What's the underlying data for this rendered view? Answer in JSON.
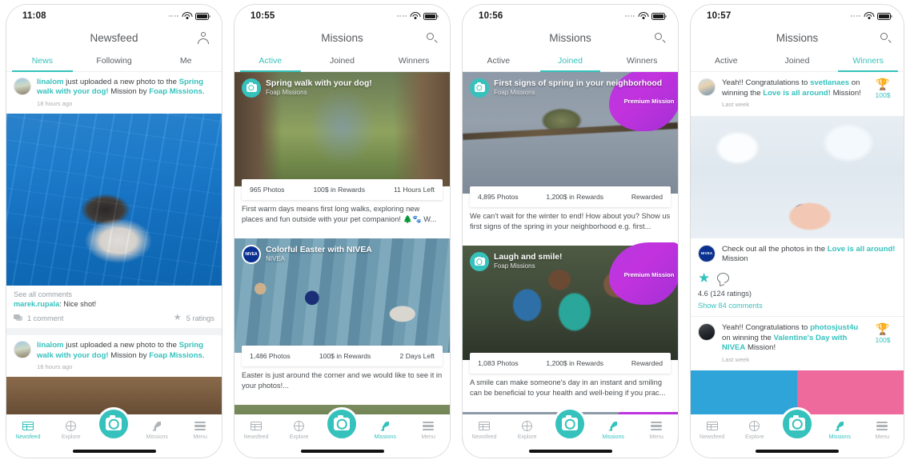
{
  "screens": [
    {
      "status": {
        "time": "11:08"
      },
      "nav": {
        "title": "Newsfeed",
        "action_icon": "person-icon"
      },
      "tabs": [
        {
          "label": "News",
          "active": true
        },
        {
          "label": "Following",
          "active": false
        },
        {
          "label": "Me",
          "active": false
        }
      ],
      "posts": [
        {
          "user": "linalom",
          "text_1": " just uploaded a new photo to the ",
          "mission": "Spring walk with your dog!",
          "text_2": " Mission by ",
          "brand": "Foap Missions",
          "text_3": ".",
          "time": "18 hours ago",
          "see_all": "See all comments",
          "comment_user": "marek.rupala",
          "comment_text": ": Nice shot!",
          "comment_count": "1 comment",
          "ratings": "5 ratings"
        },
        {
          "user": "linalom",
          "text_1": " just uploaded a new photo to the ",
          "mission": "Spring walk with your dog!",
          "text_2": " Mission by ",
          "brand": "Foap Missions",
          "text_3": ".",
          "time": "18 hours ago"
        }
      ],
      "tabbar": [
        {
          "label": "Newsfeed",
          "icon": "feed-icon",
          "active": true
        },
        {
          "label": "Explore",
          "icon": "globe-icon",
          "active": false
        },
        {
          "label": "Missions",
          "icon": "rocket-icon",
          "active": false
        },
        {
          "label": "Menu",
          "icon": "hamburger-icon",
          "active": false
        }
      ]
    },
    {
      "status": {
        "time": "10:55"
      },
      "nav": {
        "title": "Missions",
        "action_icon": "search-icon"
      },
      "tabs": [
        {
          "label": "Active",
          "active": true
        },
        {
          "label": "Joined",
          "active": false
        },
        {
          "label": "Winners",
          "active": false
        }
      ],
      "missions": [
        {
          "title": "Spring walk with your dog!",
          "sponsor": "Foap Missions",
          "logo": "camera-icon",
          "premium": false,
          "photos": "965 Photos",
          "rewards": "100$ in Rewards",
          "status": "11 Hours Left",
          "desc": "First warm days means first long walks, exploring new places and fun outside with your pet companion! 🌲🐾 W..."
        },
        {
          "title": "Colorful Easter with NIVEA",
          "sponsor": "NIVEA",
          "logo": "nivea-logo",
          "premium": false,
          "photos": "1,486 Photos",
          "rewards": "100$ in Rewards",
          "status": "2 Days Left",
          "desc": "Easter is just around the corner and we would like to see it in your photos!..."
        }
      ],
      "tabbar": [
        {
          "label": "Newsfeed",
          "icon": "feed-icon",
          "active": false
        },
        {
          "label": "Explore",
          "icon": "globe-icon",
          "active": false
        },
        {
          "label": "Missions",
          "icon": "rocket-icon",
          "active": true
        },
        {
          "label": "Menu",
          "icon": "hamburger-icon",
          "active": false
        }
      ]
    },
    {
      "status": {
        "time": "10:56"
      },
      "nav": {
        "title": "Missions",
        "action_icon": "search-icon"
      },
      "tabs": [
        {
          "label": "Active",
          "active": false
        },
        {
          "label": "Joined",
          "active": true
        },
        {
          "label": "Winners",
          "active": false
        }
      ],
      "missions": [
        {
          "title": "First signs of spring in your neighborhood",
          "sponsor": "Foap Missions",
          "logo": "camera-icon",
          "premium": true,
          "premium_label": "Premium Mission",
          "photos": "4,895 Photos",
          "rewards": "1,200$ in Rewards",
          "status": "Rewarded",
          "desc": "We can't wait for the winter to end! How about you? Show us first signs of the spring in your neighborhood e.g. first..."
        },
        {
          "title": "Laugh and smile!",
          "sponsor": "Foap Missions",
          "logo": "camera-icon",
          "premium": true,
          "premium_label": "Premium Mission",
          "photos": "1,083 Photos",
          "rewards": "1,200$ in Rewards",
          "status": "Rewarded",
          "desc": "A smile can make someone's day in an instant and smiling can be beneficial to your health and well-being if you prac..."
        }
      ],
      "tabbar": [
        {
          "label": "Newsfeed",
          "icon": "feed-icon",
          "active": false
        },
        {
          "label": "Explore",
          "icon": "globe-icon",
          "active": false
        },
        {
          "label": "Missions",
          "icon": "rocket-icon",
          "active": true
        },
        {
          "label": "Menu",
          "icon": "hamburger-icon",
          "active": false
        }
      ]
    },
    {
      "status": {
        "time": "10:57"
      },
      "nav": {
        "title": "Missions",
        "action_icon": "search-icon"
      },
      "tabs": [
        {
          "label": "Active",
          "active": false
        },
        {
          "label": "Joined",
          "active": false
        },
        {
          "label": "Winners",
          "active": true
        }
      ],
      "winners": [
        {
          "pre": "Yeah!! Congratulations to ",
          "user": "svetlanaes",
          "mid": " on winning the ",
          "mission": "Love is all around!",
          "post": " Mission!",
          "time": "Last week",
          "trophy": "trophy-icon",
          "amount": "100$",
          "caption_pre": "Check out all the photos in the ",
          "caption_mission": "Love is all around!",
          "caption_post": " Mission",
          "rating": "4.6 (124 ratings)",
          "show_comments": "Show 84 comments"
        },
        {
          "pre": "Yeah!! Congratulations to ",
          "user": "photosjust4u",
          "mid": " on winning the ",
          "mission": "Valentine's Day with NIVEA",
          "post": " Mission!",
          "time": "Last week",
          "trophy": "trophy-icon",
          "amount": "100$"
        }
      ],
      "tabbar": [
        {
          "label": "Newsfeed",
          "icon": "feed-icon",
          "active": false
        },
        {
          "label": "Explore",
          "icon": "globe-icon",
          "active": false
        },
        {
          "label": "Missions",
          "icon": "rocket-icon",
          "active": true
        },
        {
          "label": "Menu",
          "icon": "hamburger-icon",
          "active": false
        }
      ]
    }
  ],
  "brand": {
    "accent": "#35c2bd",
    "premium": "#b638e0",
    "nivea_blue": "#0a3190",
    "nivea_text": "NIVEA"
  }
}
